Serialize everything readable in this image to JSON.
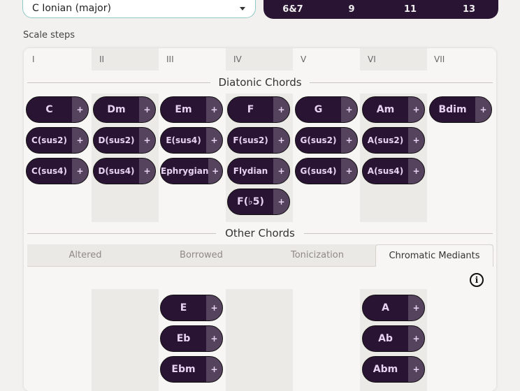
{
  "scale_select": {
    "value": "C Ionian (major)"
  },
  "extensions": [
    "6&7",
    "9",
    "11",
    "13"
  ],
  "scale_steps_label": "Scale steps",
  "steps": [
    "I",
    "II",
    "III",
    "IV",
    "V",
    "VI",
    "VII"
  ],
  "diatonic_title": "Diatonic Chords",
  "diatonic": {
    "row1": [
      "C",
      "Dm",
      "Em",
      "F",
      "G",
      "Am",
      "Bdim"
    ],
    "row2": [
      "C(sus2)",
      "D(sus2)",
      "E(sus4)",
      "F(sus2)",
      "G(sus2)",
      "A(sus2)"
    ],
    "row3": [
      "C(sus4)",
      "D(sus4)",
      "Ephrygian",
      "Flydian",
      "G(sus4)",
      "A(sus4)"
    ],
    "row4": [
      "F(♭5)"
    ]
  },
  "plus_label": "+",
  "other_title": "Other Chords",
  "tabs": [
    "Altered",
    "Borrowed",
    "Tonicization",
    "Chromatic Mediants"
  ],
  "active_tab": "Chromatic Mediants",
  "info_icon": "i",
  "mediants": {
    "col3": [
      "E",
      "Eb",
      "Ebm"
    ],
    "col6": [
      "A",
      "Ab",
      "Abm"
    ]
  },
  "colors": {
    "chord_bg": "#2a1434",
    "chord_text": "#e7d4f2",
    "plus_bg": "#55425c",
    "accent_border": "#8ec9c6"
  }
}
